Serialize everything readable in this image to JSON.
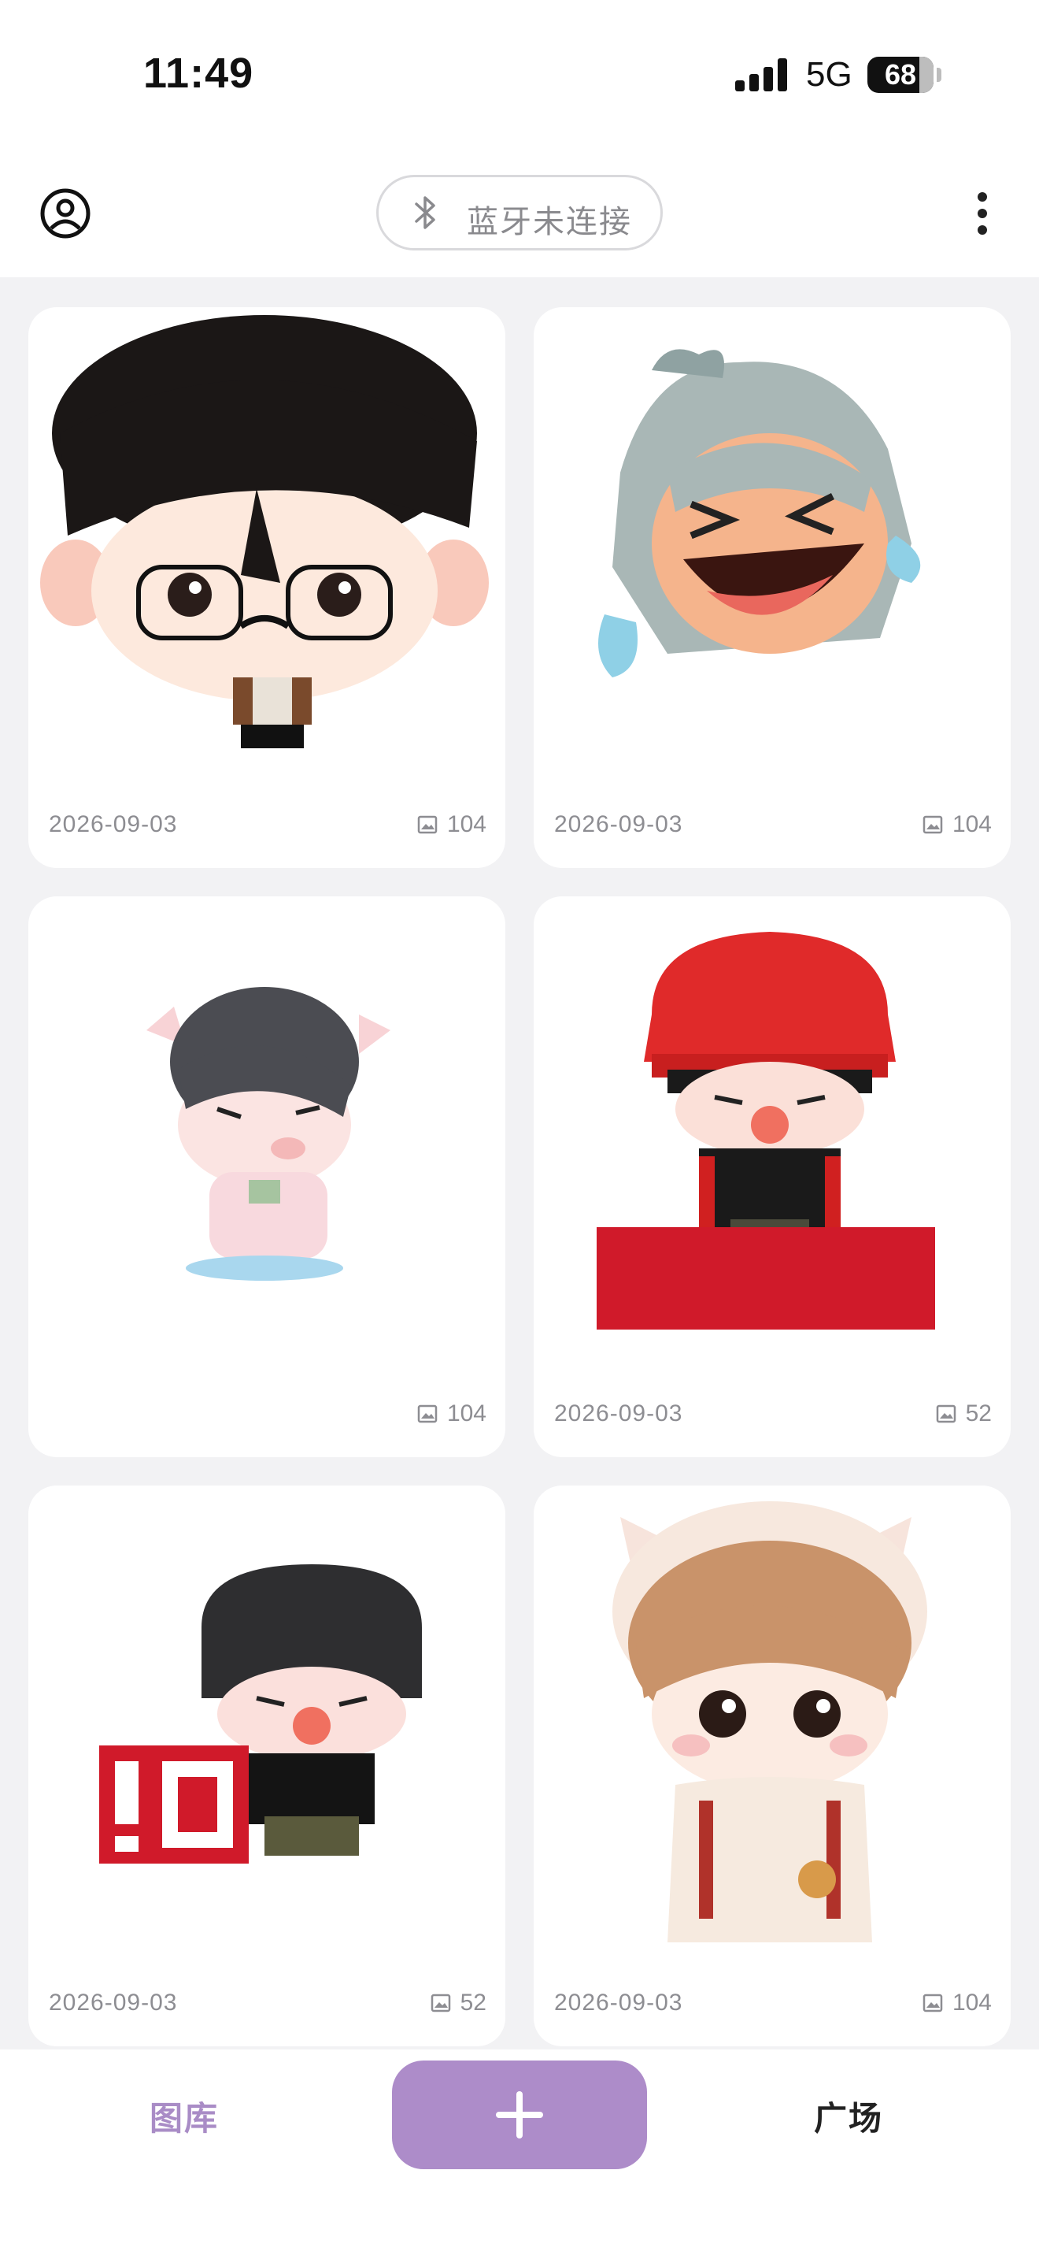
{
  "status_bar": {
    "time": "11:49",
    "network": "5G",
    "battery": "68"
  },
  "header": {
    "profile_icon": "user-circle-icon",
    "bluetooth_icon": "bluetooth-icon",
    "bluetooth_status": "蓝牙未连接",
    "more_icon": "more-vertical-icon"
  },
  "gallery": {
    "items": [
      {
        "date": "2026-09-03",
        "count": "104",
        "art": "pixel-boy-glasses"
      },
      {
        "date": "2026-09-03",
        "count": "104",
        "art": "pixel-laughing-girl"
      },
      {
        "date": "",
        "count": "104",
        "art": "pixel-pig-boy"
      },
      {
        "date": "2026-09-03",
        "count": "52",
        "art": "pixel-red-hat-boy"
      },
      {
        "date": "2026-09-03",
        "count": "52",
        "art": "pixel-black-hair-boy"
      },
      {
        "date": "2026-09-03",
        "count": "104",
        "art": "pixel-cat-hood-boy"
      }
    ]
  },
  "bottom_nav": {
    "gallery_label": "图库",
    "add_icon": "plus-icon",
    "plaza_label": "广场"
  },
  "colors": {
    "accent": "#ad8cc9",
    "accent_text": "#a98cc6",
    "background": "#f2f2f4",
    "meta_text": "#8d8d92"
  }
}
